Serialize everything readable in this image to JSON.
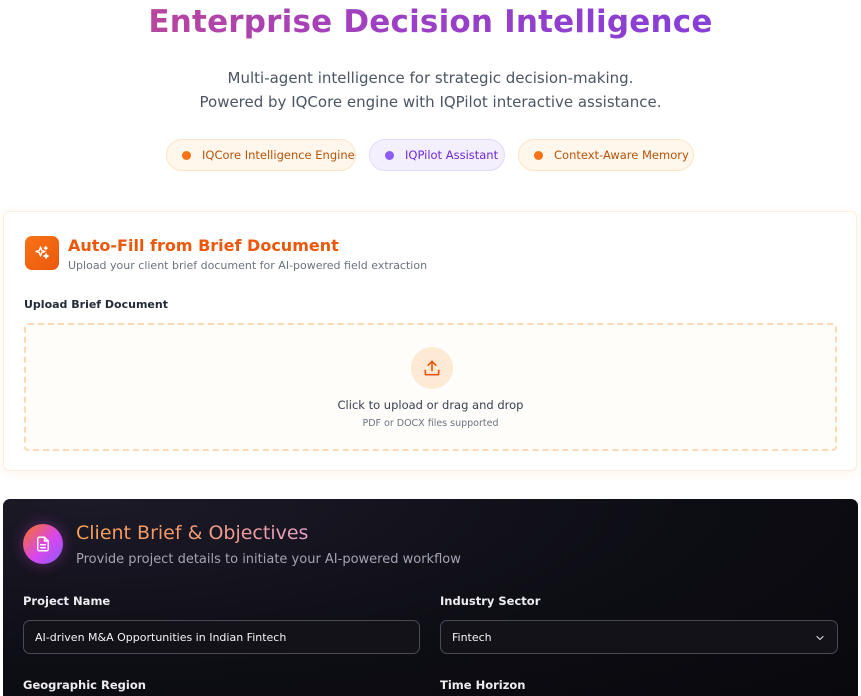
{
  "header": {
    "title": "Enterprise Decision Intelligence",
    "subtitle_line1": "Multi-agent intelligence for strategic decision-making.",
    "subtitle_line2": "Powered by IQCore engine with IQPilot interactive assistance."
  },
  "badges": [
    {
      "label": "IQCore Intelligence Engine",
      "color": "#f97316"
    },
    {
      "label": "IQPilot Assistant",
      "color": "#8b5cf6"
    },
    {
      "label": "Context-Aware Memory",
      "color": "#f97316"
    }
  ],
  "autofill": {
    "title": "Auto-Fill from Brief Document",
    "description": "Upload your client brief document for AI-powered field extraction",
    "upload_label": "Upload Brief Document",
    "dropzone_text": "Click to upload or drag and drop",
    "dropzone_hint": "PDF or DOCX files supported",
    "icon": "sparkles-icon",
    "accent": "#ea580c"
  },
  "brief": {
    "title": "Client Brief & Objectives",
    "description": "Provide project details to initiate your AI-powered workflow",
    "icon": "document-icon",
    "fields": {
      "project_name": {
        "label": "Project Name",
        "value": "AI-driven M&A Opportunities in Indian Fintech"
      },
      "industry_sector": {
        "label": "Industry Sector",
        "value": "Fintech"
      },
      "geographic_region": {
        "label": "Geographic Region"
      },
      "time_horizon": {
        "label": "Time Horizon"
      }
    }
  }
}
